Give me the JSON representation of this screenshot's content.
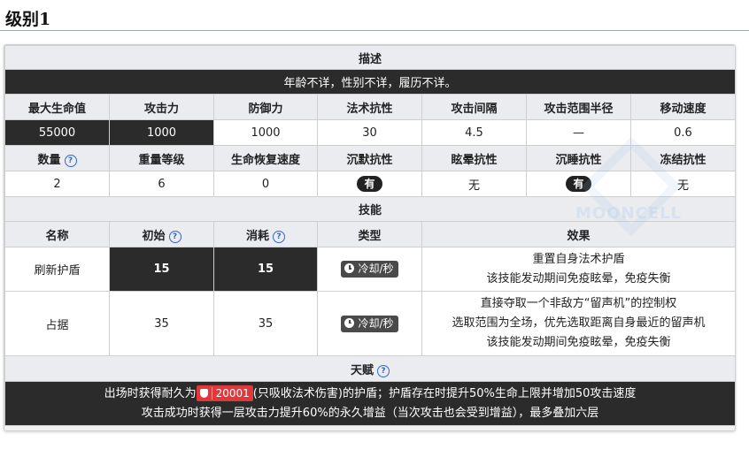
{
  "page": {
    "title": "级别1"
  },
  "description": {
    "header": "描述",
    "text": "年龄不详，性别不详，履历不详。"
  },
  "stats": {
    "headers1": [
      "最大生命值",
      "攻击力",
      "防御力",
      "法术抗性",
      "攻击间隔",
      "攻击范围半径",
      "移动速度"
    ],
    "values1": [
      "55000",
      "1000",
      "1000",
      "30",
      "4.5",
      "—",
      "0.6"
    ],
    "headers2": [
      "数量",
      "重量等级",
      "生命恢复速度",
      "沉默抗性",
      "眩晕抗性",
      "沉睡抗性",
      "冻结抗性"
    ],
    "values2": [
      "2",
      "6",
      "0",
      "有",
      "无",
      "有",
      "无"
    ]
  },
  "skills": {
    "section_label": "技能",
    "headers": {
      "name": "名称",
      "initial": "初始",
      "cost": "消耗",
      "type": "类型",
      "effect": "效果"
    },
    "rows": [
      {
        "name": "刷新护盾",
        "initial": "15",
        "cost": "15",
        "type": "冷却/秒",
        "effect": [
          "重置自身法术护盾",
          "该技能发动期间免疫眩晕，免疫失衡"
        ]
      },
      {
        "name": "占据",
        "initial": "35",
        "cost": "35",
        "type": "冷却/秒",
        "effect": [
          "直接夺取一个非敌方“留声机”的控制权",
          "选取范围为全场，优先选取距离自身最近的留声机",
          "该技能发动期间免疫眩晕，免疫失衡"
        ]
      }
    ]
  },
  "talent": {
    "section_label": "天赋",
    "line1_before": "出场时获得耐久为",
    "shield_value": "20001",
    "line1_after": "(只吸收法术伤害)的护盾；护盾存在时提升50%生命上限并增加50攻击速度",
    "line2": "攻击成功时获得一层攻击力提升60%的永久增益（当次攻击也会受到增益），最多叠加六层"
  },
  "watermark": "MOONCELL",
  "colors": {
    "dark_cell": "#2b2b2b",
    "header_bg": "#eaecf0",
    "badge_red": "#e0383b",
    "help_blue": "#3366cc"
  }
}
